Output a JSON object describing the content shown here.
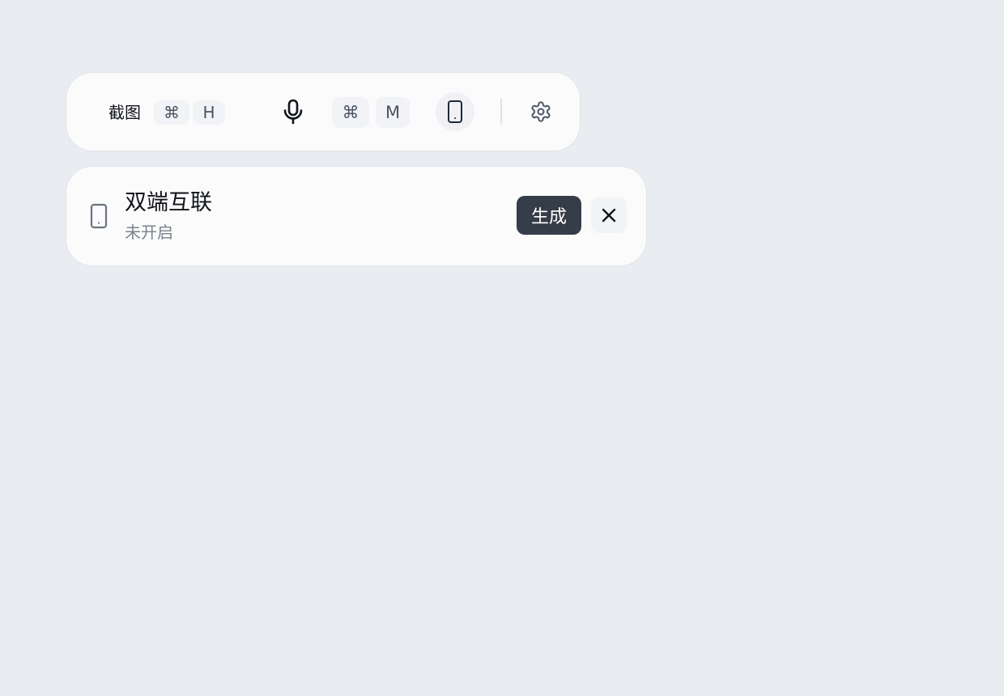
{
  "toolbar": {
    "screenshot_label": "截图",
    "screenshot_shortcut": [
      "⌘",
      "H"
    ],
    "mic_icon": "microphone-icon",
    "mic_shortcut": [
      "⌘",
      "M"
    ],
    "device_icon": "tablet-icon",
    "settings_icon": "gear-icon"
  },
  "panel": {
    "icon": "tablet-icon",
    "title": "双端互联",
    "status": "未开启",
    "generate_label": "生成",
    "close_icon": "close-icon"
  },
  "colors": {
    "background": "#e9ecf1",
    "card": "#fbfbfc",
    "primary_button": "#353d48",
    "key_badge": "#f1f3f6"
  }
}
